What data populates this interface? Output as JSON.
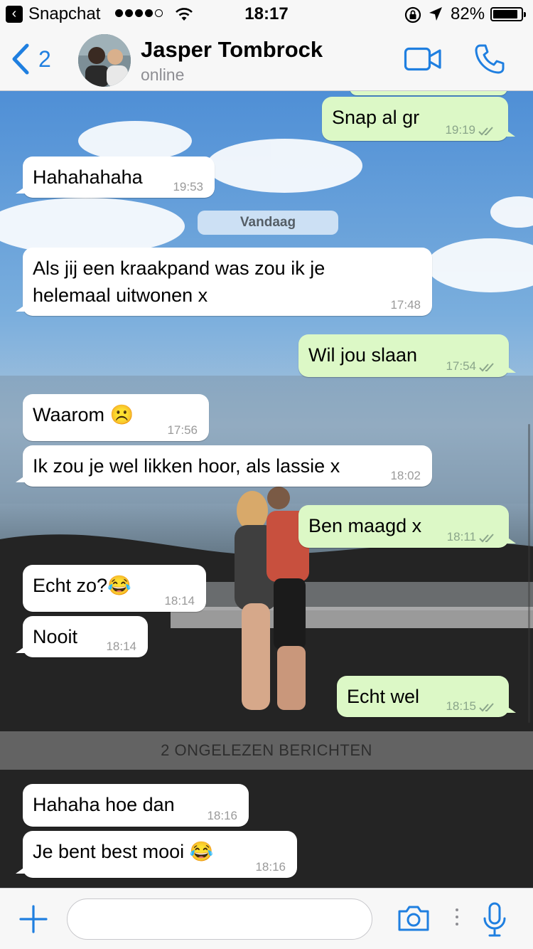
{
  "status_bar": {
    "app_name": "Snapchat",
    "back_glyph": "‹",
    "time": "18:17",
    "battery": "82%",
    "battery_level": 0.82,
    "signal_bars_filled": 4
  },
  "header": {
    "back_count": "2",
    "contact_name": "Jasper Tombrock",
    "contact_status": "online"
  },
  "chat": {
    "date_separator": "Vandaag",
    "unread_separator": "2 ONGELEZEN BERICHTEN",
    "messages": [
      {
        "direction": "out",
        "text": "Snap al gr",
        "time": "19:19"
      },
      {
        "direction": "in",
        "text": "Hahahahaha",
        "time": "19:53"
      },
      {
        "direction": "in",
        "text": "Als jij een kraakpand was zou ik je helemaal uitwonen x",
        "time": "17:48"
      },
      {
        "direction": "out",
        "text": "Wil jou slaan",
        "time": "17:54"
      },
      {
        "direction": "in",
        "text": "Waarom ☹️",
        "time": "17:56"
      },
      {
        "direction": "in",
        "text": "Ik zou je wel likken hoor, als lassie x",
        "time": "18:02"
      },
      {
        "direction": "out",
        "text": "Ben maagd x",
        "time": "18:11"
      },
      {
        "direction": "in",
        "text": "Echt zo?😂",
        "time": "18:14"
      },
      {
        "direction": "in",
        "text": "Nooit",
        "time": "18:14"
      },
      {
        "direction": "out",
        "text": "Echt wel",
        "time": "18:15"
      },
      {
        "direction": "in",
        "text": "Hahaha hoe dan",
        "time": "18:16"
      },
      {
        "direction": "in",
        "text": "Je bent best mooi 😂",
        "time": "18:16"
      }
    ]
  },
  "input_bar": {
    "message_value": "",
    "message_placeholder": ""
  },
  "icons": {
    "back": "chevron-left-icon",
    "video": "video-camera-icon",
    "call": "phone-icon",
    "attach": "plus-icon",
    "camera": "camera-icon",
    "mic": "microphone-icon"
  },
  "colors": {
    "accent": "#1f7fe0",
    "outgoing_bubble": "#dcf8c6",
    "incoming_bubble": "#ffffff"
  }
}
